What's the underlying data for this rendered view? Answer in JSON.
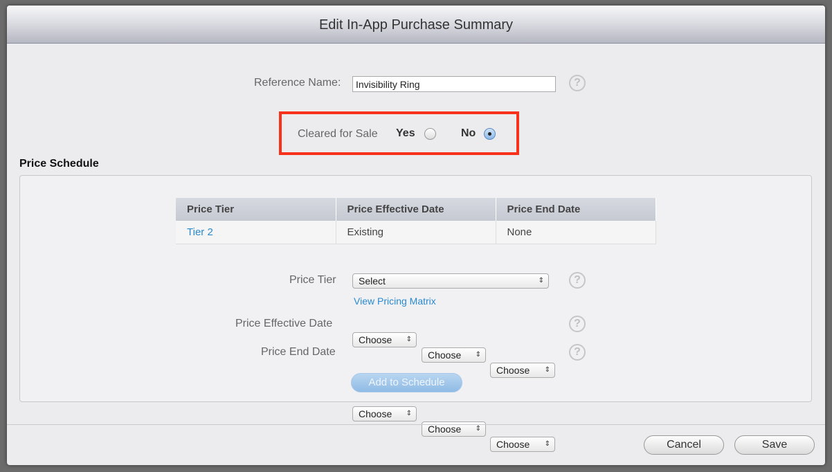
{
  "dialog": {
    "title": "Edit In-App Purchase Summary"
  },
  "reference": {
    "label": "Reference Name:",
    "value": "Invisibility Ring"
  },
  "cleared": {
    "label": "Cleared for Sale",
    "yes": "Yes",
    "no": "No",
    "selected": "No"
  },
  "price_schedule": {
    "title": "Price Schedule",
    "columns": [
      "Price Tier",
      "Price Effective Date",
      "Price End Date"
    ],
    "rows": [
      [
        "Tier 2",
        "Existing",
        "None"
      ]
    ]
  },
  "form": {
    "price_tier_label": "Price Tier",
    "price_tier_value": "Select",
    "pricing_matrix_link": "View Pricing Matrix",
    "effective_label": "Price Effective Date",
    "end_label": "Price End Date",
    "choose": "Choose",
    "add_button": "Add to Schedule"
  },
  "help": "?",
  "footer": {
    "cancel": "Cancel",
    "save": "Save"
  },
  "colors": {
    "highlight": "#f8311b",
    "link": "#2a8ad0"
  }
}
